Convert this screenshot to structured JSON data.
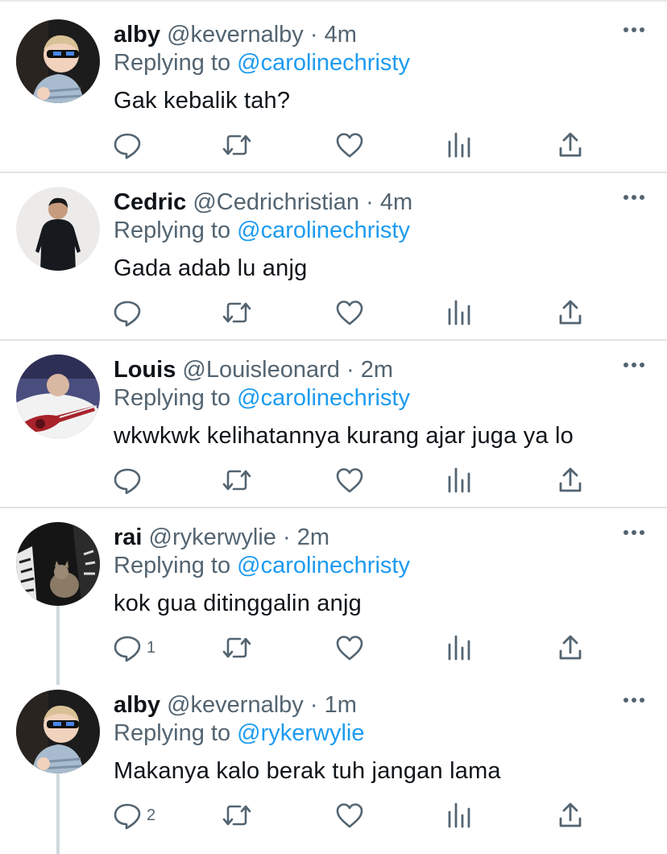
{
  "tweets": [
    {
      "name": "alby",
      "handle": "@kevernalby",
      "separator": "·",
      "time": "4m",
      "replying_label": "Replying to",
      "replying_to": "@carolinechristy",
      "text": "Gak kebalik tah?",
      "reply_count": "",
      "avatar": "boy-with-sunglasses"
    },
    {
      "name": "Cedric",
      "handle": "@Cedrichristian",
      "separator": "·",
      "time": "4m",
      "replying_label": "Replying to",
      "replying_to": "@carolinechristy",
      "text": "Gada adab lu anjg",
      "reply_count": "",
      "avatar": "man-in-black-shirt"
    },
    {
      "name": "Louis",
      "handle": "@Louisleonard",
      "separator": "·",
      "time": "2m",
      "replying_label": "Replying to",
      "replying_to": "@carolinechristy",
      "text": "wkwkwk kelihatannya kurang ajar juga ya lo",
      "reply_count": "",
      "avatar": "guitar-player"
    },
    {
      "name": "rai",
      "handle": "@rykerwylie",
      "separator": "·",
      "time": "2m",
      "replying_label": "Replying to",
      "replying_to": "@carolinechristy",
      "text": "kok gua ditinggalin anjg",
      "reply_count": "1",
      "avatar": "cat-and-skeleton"
    },
    {
      "name": "alby",
      "handle": "@kevernalby",
      "separator": "·",
      "time": "1m",
      "replying_label": "Replying to",
      "replying_to": "@rykerwylie",
      "text": "Makanya kalo berak tuh jangan lama",
      "reply_count": "2",
      "avatar": "boy-with-sunglasses"
    }
  ],
  "icons": {
    "reply": "reply-icon",
    "retweet": "retweet-icon",
    "like": "heart-icon",
    "views": "views-icon",
    "share": "share-icon",
    "more": "more-dots-icon"
  },
  "colors": {
    "text": "#0f1419",
    "secondary": "#536471",
    "mention": "#1d9bf0",
    "divider": "#e1e5e8",
    "thread_line": "#cfd9de"
  }
}
